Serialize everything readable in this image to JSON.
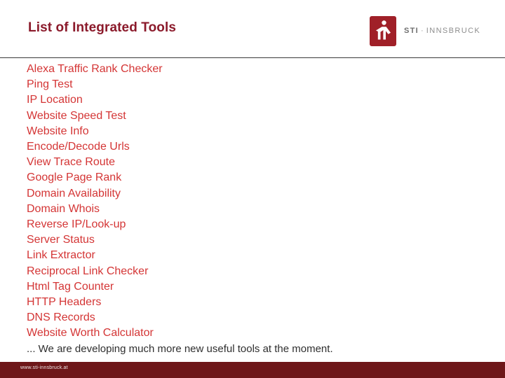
{
  "header": {
    "title": "List of Integrated Tools",
    "logo": {
      "icon_name": "sti-person-mark-icon",
      "brand_primary": "STI",
      "separator": "·",
      "brand_secondary": "INNSBRUCK",
      "mark_color": "#a02028",
      "text_color": "#8e8e8e"
    }
  },
  "main": {
    "tools": [
      "Alexa Traffic Rank Checker",
      "Ping Test",
      "IP Location",
      "Website Speed Test",
      "Website Info",
      "Encode/Decode Urls",
      "View Trace Route",
      "Google Page Rank",
      "Domain Availability",
      "Domain Whois",
      "Reverse IP/Look-up",
      "Server Status",
      "Link Extractor",
      "Reciprocal Link Checker",
      "Html Tag Counter",
      "HTTP Headers",
      "DNS Records",
      "Website Worth Calculator"
    ],
    "closing_note": "... We are developing much more new useful tools at the moment.",
    "list_color": "#d43535",
    "note_color": "#2f2f2f",
    "title_color": "#8b1a2b"
  },
  "footer": {
    "url": "www.sti-innsbruck.at",
    "bar_color": "#6e1719",
    "text_color": "#f0e8e8"
  }
}
